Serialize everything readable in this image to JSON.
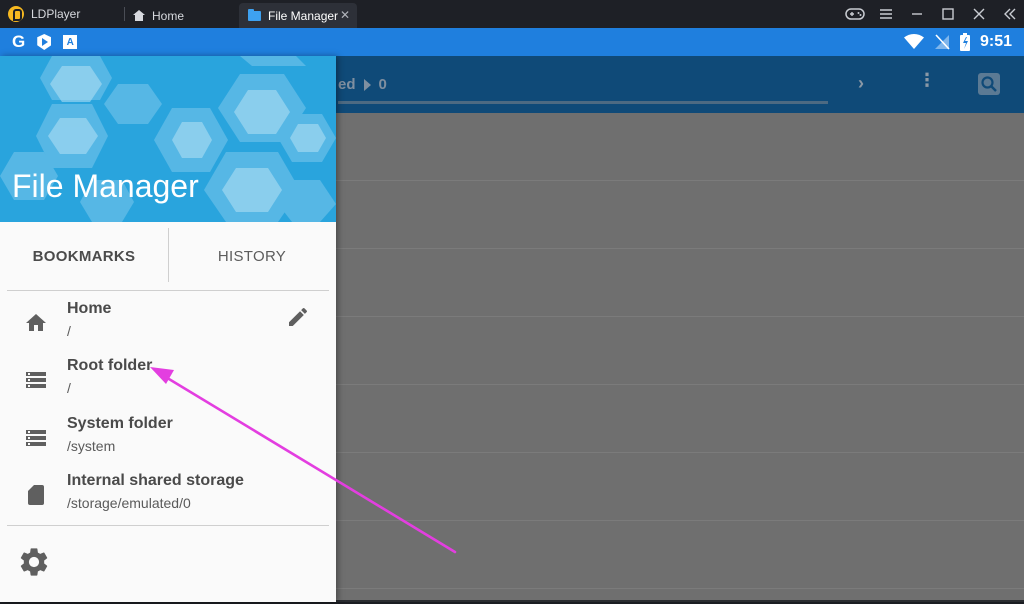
{
  "window": {
    "app_name": "LDPlayer",
    "tabs": [
      {
        "label": "Home"
      },
      {
        "label": "File Manager"
      }
    ]
  },
  "status_bar": {
    "time": "9:51",
    "left_icons": [
      "google-icon",
      "play-protect-icon",
      "a-icon"
    ],
    "right_icons": [
      "wifi-icon",
      "no-signal-icon",
      "battery-icon"
    ],
    "color": "#1f7fde"
  },
  "app_toolbar": {
    "breadcrumb_partial": "ed",
    "breadcrumb_count": "0",
    "color": "#0f4a78"
  },
  "drawer": {
    "title": "File Manager",
    "tabs": {
      "bookmarks": "BOOKMARKS",
      "history": "HISTORY"
    },
    "bookmarks": [
      {
        "title": "Home",
        "path": "/",
        "icon": "home-icon"
      },
      {
        "title": "Root folder",
        "path": "/",
        "icon": "storage-icon"
      },
      {
        "title": "System folder",
        "path": "/system",
        "icon": "storage-icon"
      },
      {
        "title": "Internal shared storage",
        "path": "/storage/emulated/0",
        "icon": "sd-card-icon"
      }
    ],
    "header_color": "#29a4dd"
  },
  "annotation": {
    "arrow_color": "#e33ee0"
  }
}
